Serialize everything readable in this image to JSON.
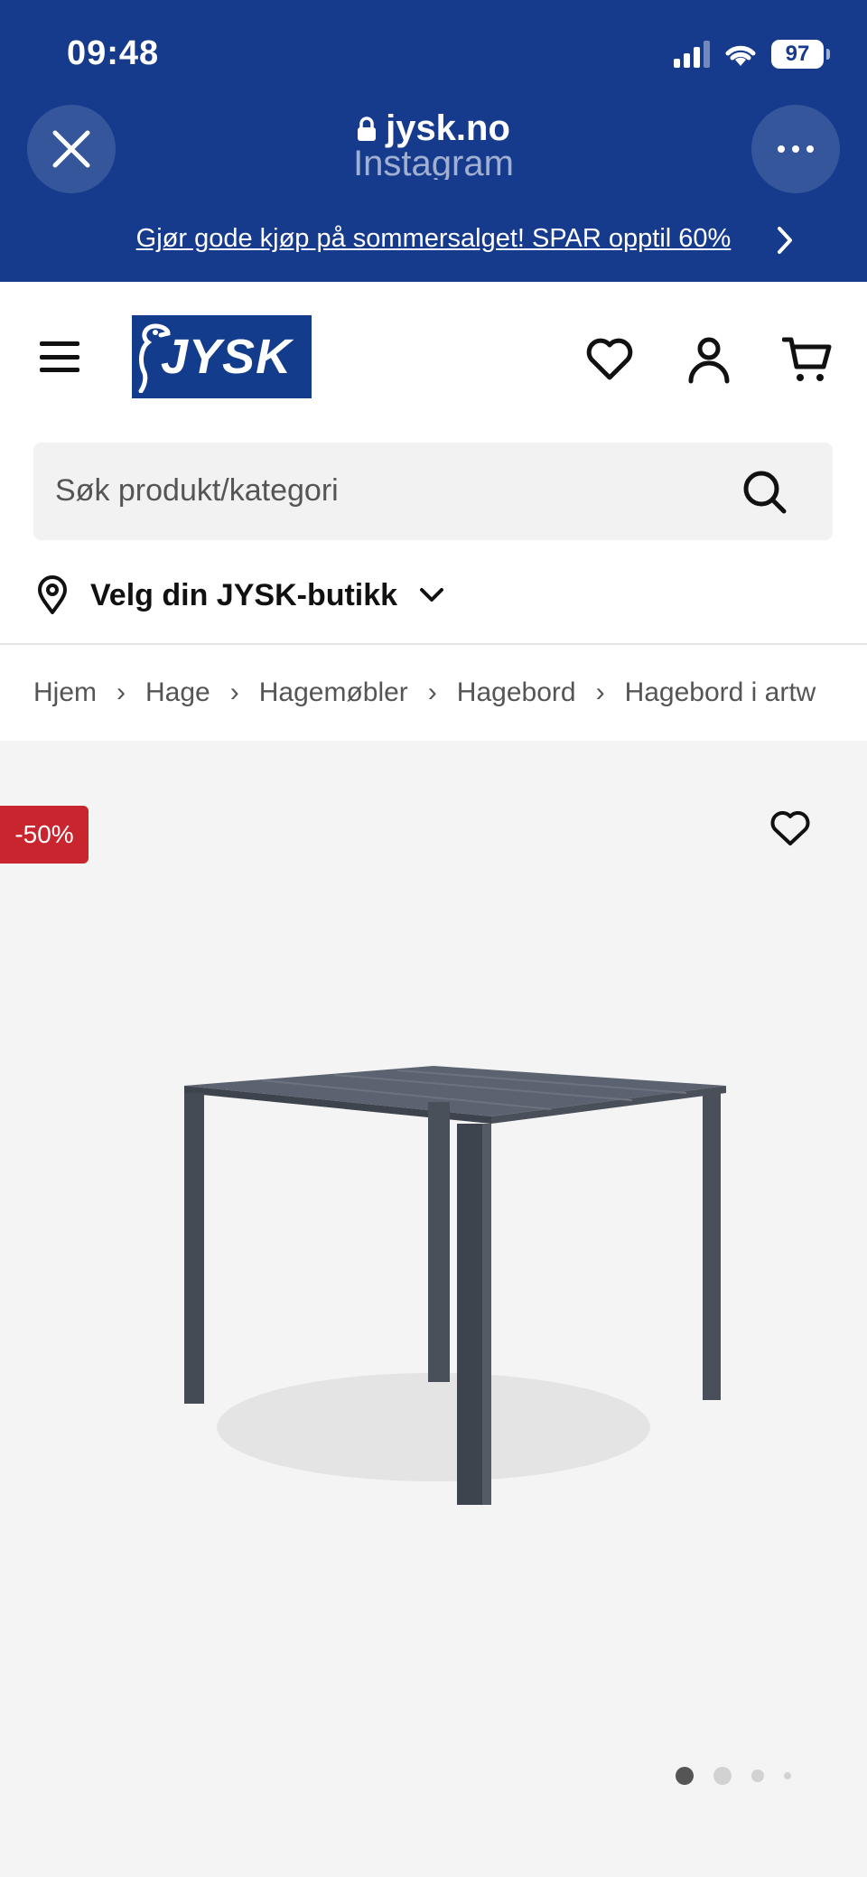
{
  "status_bar": {
    "time": "09:48",
    "battery": "97"
  },
  "browser": {
    "domain": "jysk.no",
    "source": "Instagram",
    "promo_text": "Gjør gode kjøp på sommersalget! SPAR opptil 60%"
  },
  "header": {
    "logo_text": "JYSK",
    "search_placeholder": "Søk produkt/kategori",
    "store_label": "Velg din JYSK-butikk"
  },
  "breadcrumb": [
    "Hjem",
    "Hage",
    "Hagemøbler",
    "Hagebord",
    "Hagebord i artw"
  ],
  "product": {
    "discount_badge": "-50%",
    "gallery": {
      "image_count": 4,
      "active_index": 0
    }
  },
  "colors": {
    "brand_blue": "#163b8c",
    "logo_blue": "#143c8c",
    "sale_red": "#c9252f"
  }
}
